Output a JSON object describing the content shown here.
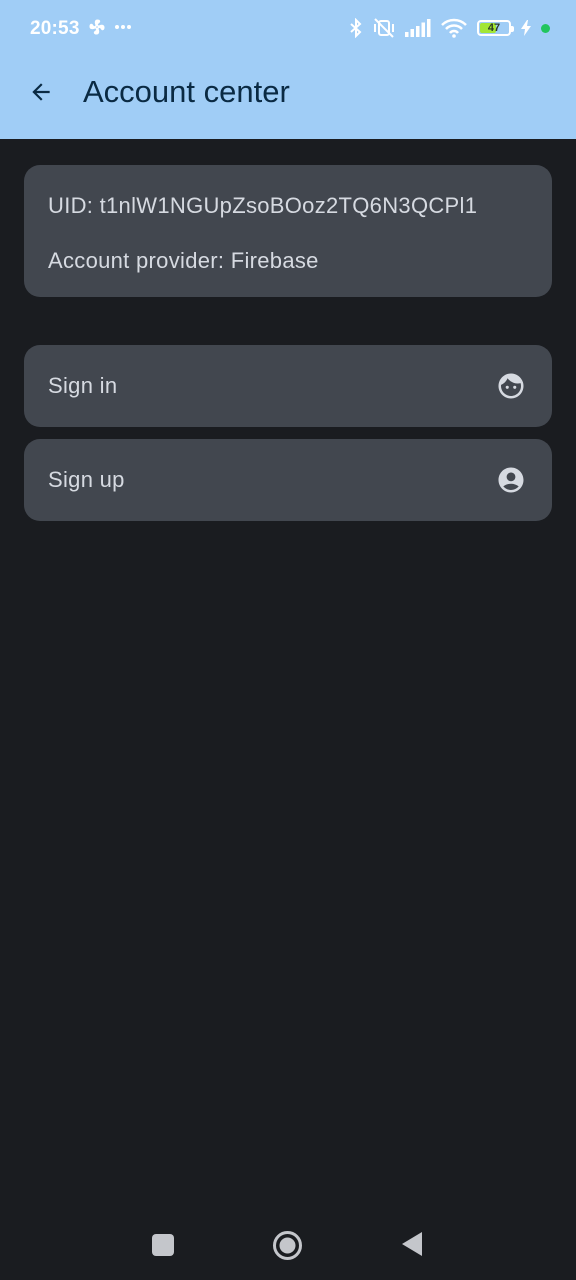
{
  "status_bar": {
    "time": "20:53",
    "battery_level": "47",
    "icons": [
      "fan-icon",
      "more-dots-icon",
      "bluetooth-icon",
      "vibrate-off-icon",
      "signal-icon",
      "wifi-icon",
      "battery-icon",
      "charging-icon",
      "green-dot-icon"
    ]
  },
  "appbar": {
    "back_icon": "arrow-left-icon",
    "title": "Account center"
  },
  "account_info": {
    "uid": "UID: t1nlW1NGUpZsoBOoz2TQ6N3QCPl1",
    "provider": "Account provider: Firebase"
  },
  "actions": [
    {
      "label": "Sign in",
      "icon": "face-icon"
    },
    {
      "label": "Sign up",
      "icon": "account-circle-icon"
    }
  ],
  "colors": {
    "header_bg": "#a0cdf6",
    "page_bg": "#1a1c20",
    "card_bg": "#42474f",
    "text": "#d6dae1",
    "title_text": "#0a2a43"
  }
}
